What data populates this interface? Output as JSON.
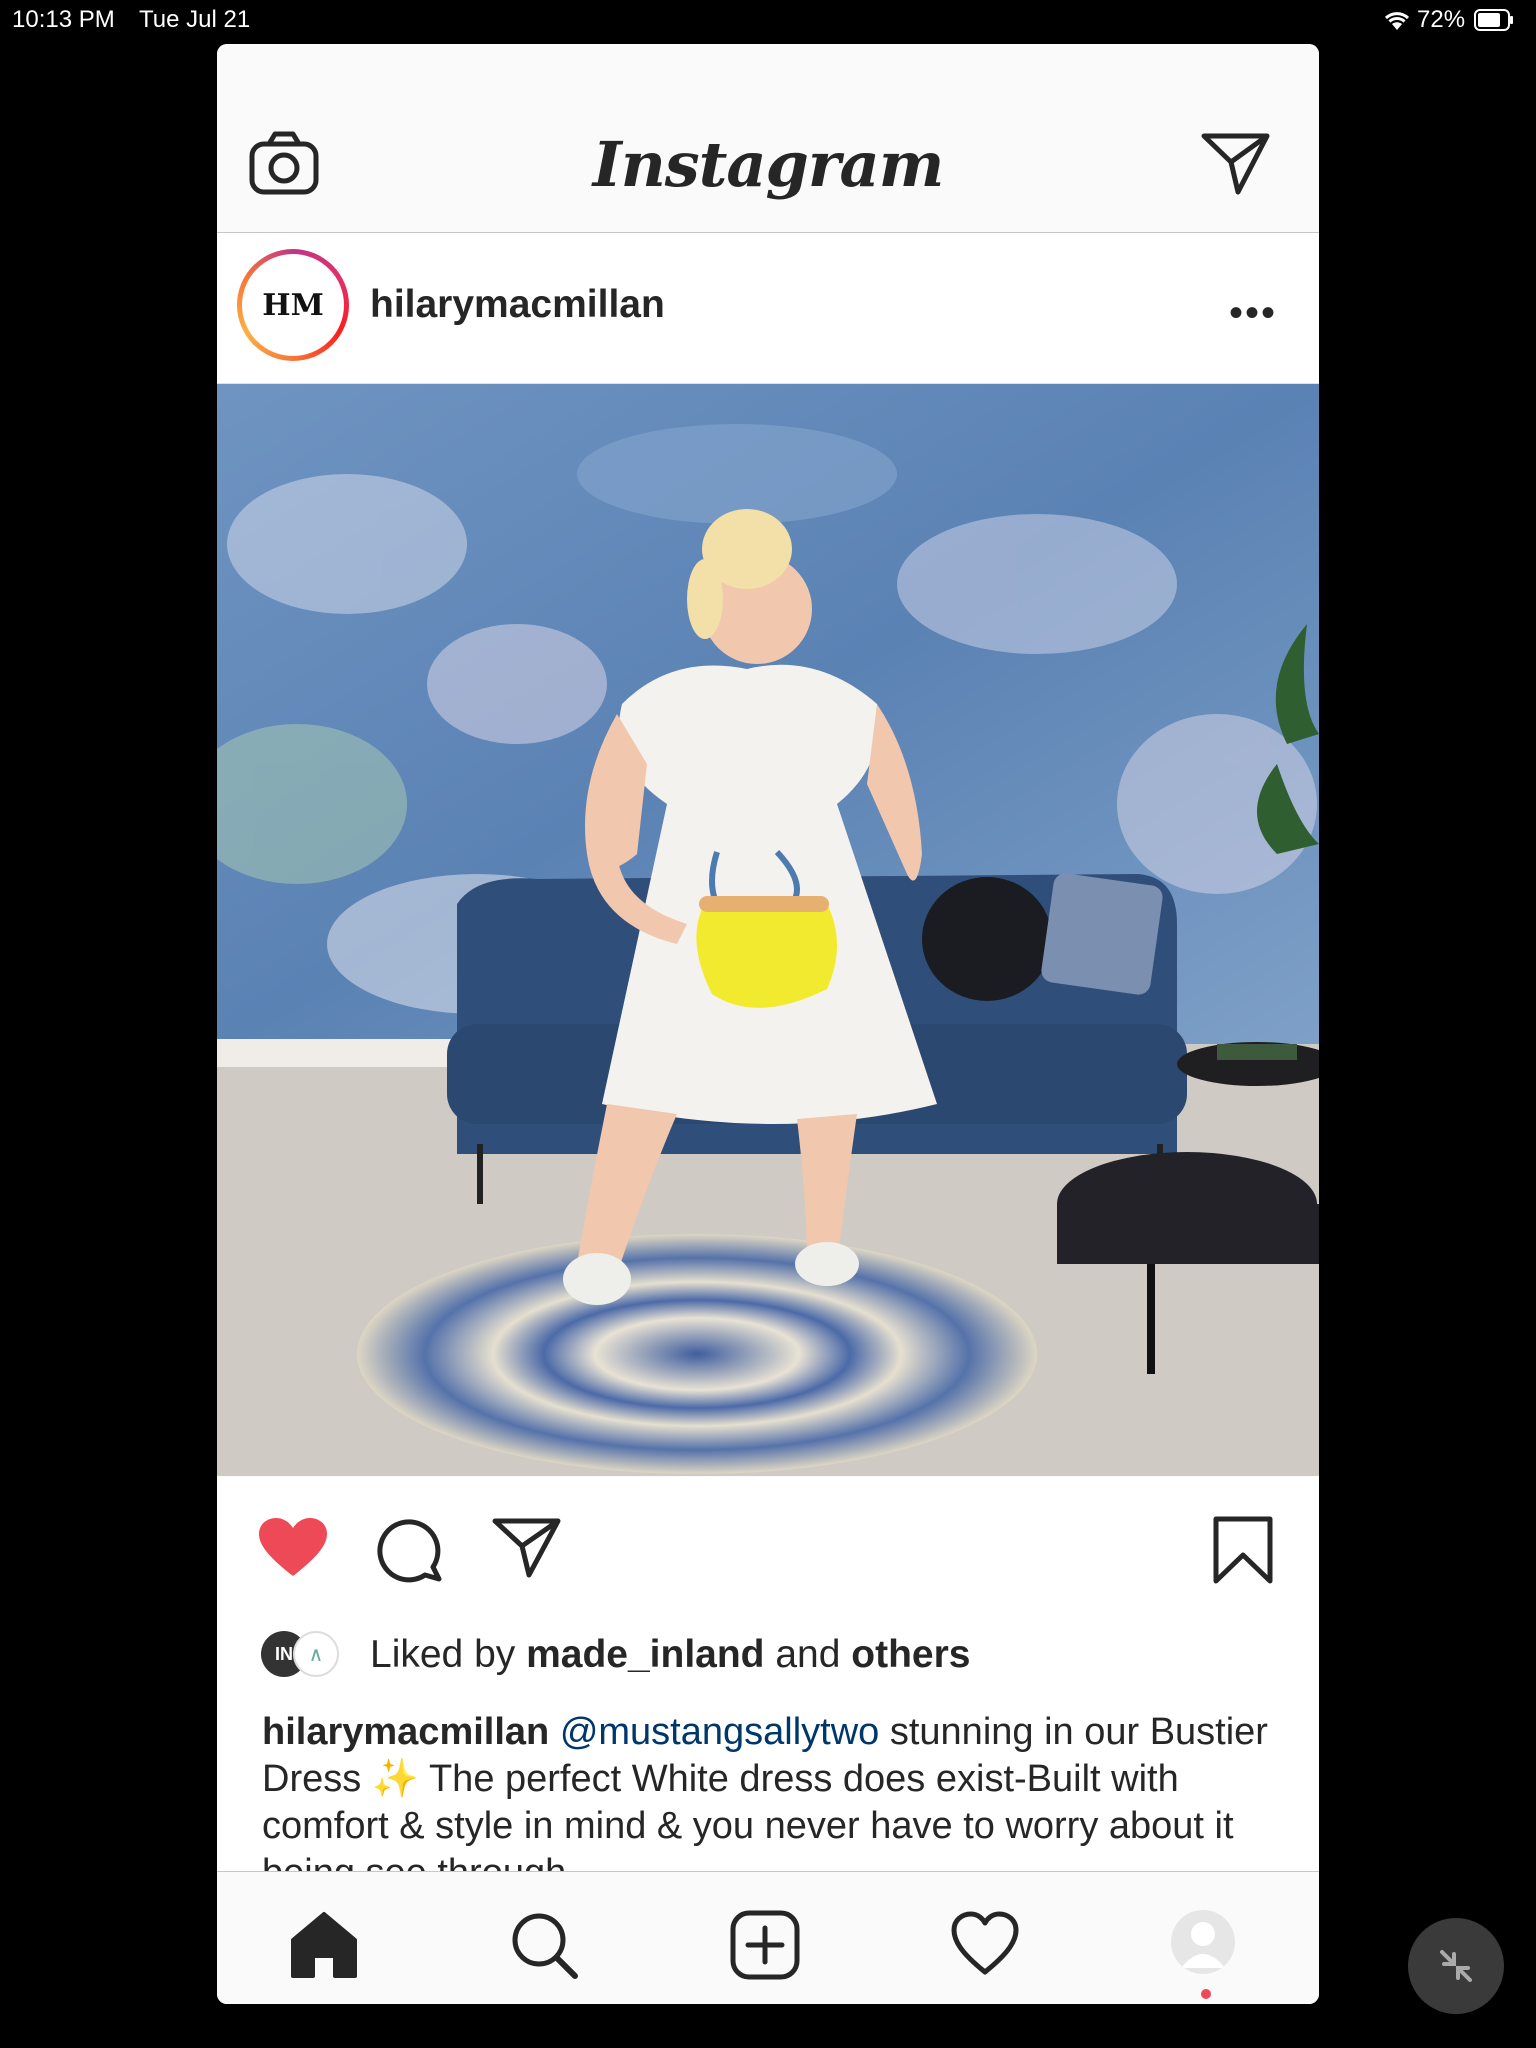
{
  "status_bar": {
    "time": "10:13 PM",
    "date": "Tue Jul 21",
    "battery": "72%",
    "icons": [
      "wifi-icon",
      "battery-icon"
    ]
  },
  "header": {
    "logo": "Instagram",
    "icons": [
      "camera-icon",
      "direct-message-icon"
    ]
  },
  "post": {
    "username": "hilarymacmillan",
    "avatar_text": "HM",
    "more": "•••",
    "liked_by_prefix": "Liked by",
    "liked_by_user": "made_inland",
    "liked_by_and": "and",
    "liked_by_others": "others",
    "liker_avatar_text": "IN",
    "caption_user": "hilarymacmillan",
    "caption_mention": "@mustangsallytwo",
    "caption_body": " stunning in our Bustier Dress ✨  The perfect White dress does exist-Built with comfort & style in mind & you never have to worry about it being see through.",
    "liked": true,
    "colors": {
      "heart": "#ed4956",
      "mention": "#00376b",
      "text": "#262626"
    }
  },
  "tab_bar": {
    "items": [
      "home-icon",
      "search-icon",
      "new-post-icon",
      "activity-heart-icon",
      "profile-avatar"
    ]
  }
}
